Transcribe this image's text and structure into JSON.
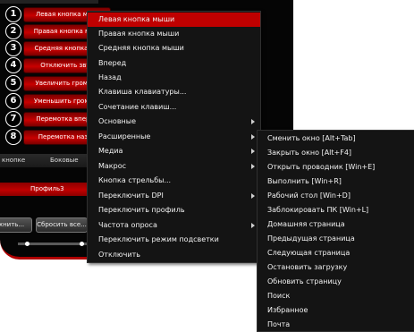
{
  "side_buttons": [
    {
      "num": "1",
      "label": "Левая кнопка мыш"
    },
    {
      "num": "2",
      "label": "Правая кнопка мыш"
    },
    {
      "num": "3",
      "label": "Средняя кнопка мы"
    },
    {
      "num": "4",
      "label": "Отключить звук"
    },
    {
      "num": "5",
      "label": "Увеличить громкос"
    },
    {
      "num": "6",
      "label": "Уменьшить громкос"
    },
    {
      "num": "7",
      "label": "Перемотка вперед"
    },
    {
      "num": "8",
      "label": "Перемотка назад"
    }
  ],
  "side_strip": {
    "left": "кнопке",
    "right": "Боковые"
  },
  "profile": {
    "label": "Профиль3"
  },
  "bottom_buttons": {
    "left": "хнить...",
    "reset": "Сбросить все..."
  },
  "context_menu": {
    "items": [
      {
        "label": "Левая кнопка мыши",
        "submenu": false
      },
      {
        "label": "Правая кнопка мыши",
        "submenu": false
      },
      {
        "label": "Средняя кнопка мыши",
        "submenu": false
      },
      {
        "label": "Вперед",
        "submenu": false
      },
      {
        "label": "Назад",
        "submenu": false
      },
      {
        "label": "Клавиша клавиатуры...",
        "submenu": false
      },
      {
        "label": "Сочетание клавиш...",
        "submenu": false
      },
      {
        "label": "Основные",
        "submenu": true
      },
      {
        "label": "Расширенные",
        "submenu": true
      },
      {
        "label": "Медиа",
        "submenu": true
      },
      {
        "label": "Макрос",
        "submenu": true
      },
      {
        "label": "Кнопка стрельбы...",
        "submenu": false
      },
      {
        "label": "Переключить DPI",
        "submenu": true
      },
      {
        "label": "Переключить профиль",
        "submenu": false
      },
      {
        "label": "Частота опроса",
        "submenu": true
      },
      {
        "label": "Переключить режим подсветки",
        "submenu": false
      },
      {
        "label": "Отключить",
        "submenu": false
      }
    ],
    "highlighted": "Левая кнопка мыши"
  },
  "submenu": {
    "items": [
      "Сменить окно [Alt+Tab]",
      "Закрыть окно [Alt+F4]",
      "Открыть проводник [Win+E]",
      "Выполнить [Win+R]",
      "Рабочий стол [Win+D]",
      "Заблокировать ПК [Win+L]",
      "Домашняя страница",
      "Предыдущая страница",
      "Следующая страница",
      "Остановить загрузку",
      "Обновить страницу",
      "Поиск",
      "Избранное",
      "Почта"
    ]
  },
  "colors": {
    "accent": "#bf0000",
    "menu_bg": "#141414",
    "app_bg": "#050505"
  }
}
